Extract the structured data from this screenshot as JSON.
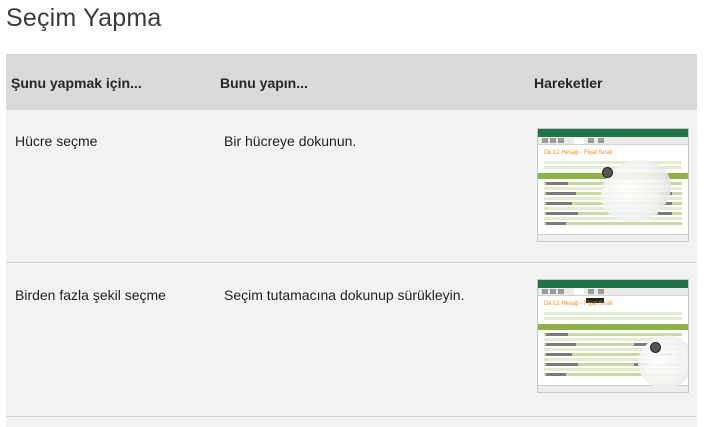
{
  "page": {
    "title": "Seçim Yapma"
  },
  "table": {
    "headers": [
      "Şunu yapmak için...",
      "Bunu yapın...",
      "Hareketler"
    ],
    "rows": [
      {
        "task": "Hücre seçme",
        "action": "Bir hücreye dokunun.",
        "gesture_image": "tap-gesture-image"
      },
      {
        "task": "Birden fazla şekil seçme",
        "action": "Seçim tutamacına dokunup sürükleyin.",
        "gesture_image": "drag-gesture-image"
      }
    ]
  },
  "thumbnails": {
    "sheet_title": "Dk 12 Hesap - Fiyat Sıralı",
    "accent_color": "#217346",
    "highlight_color": "#f08a24",
    "table_color": "#8fb247"
  }
}
